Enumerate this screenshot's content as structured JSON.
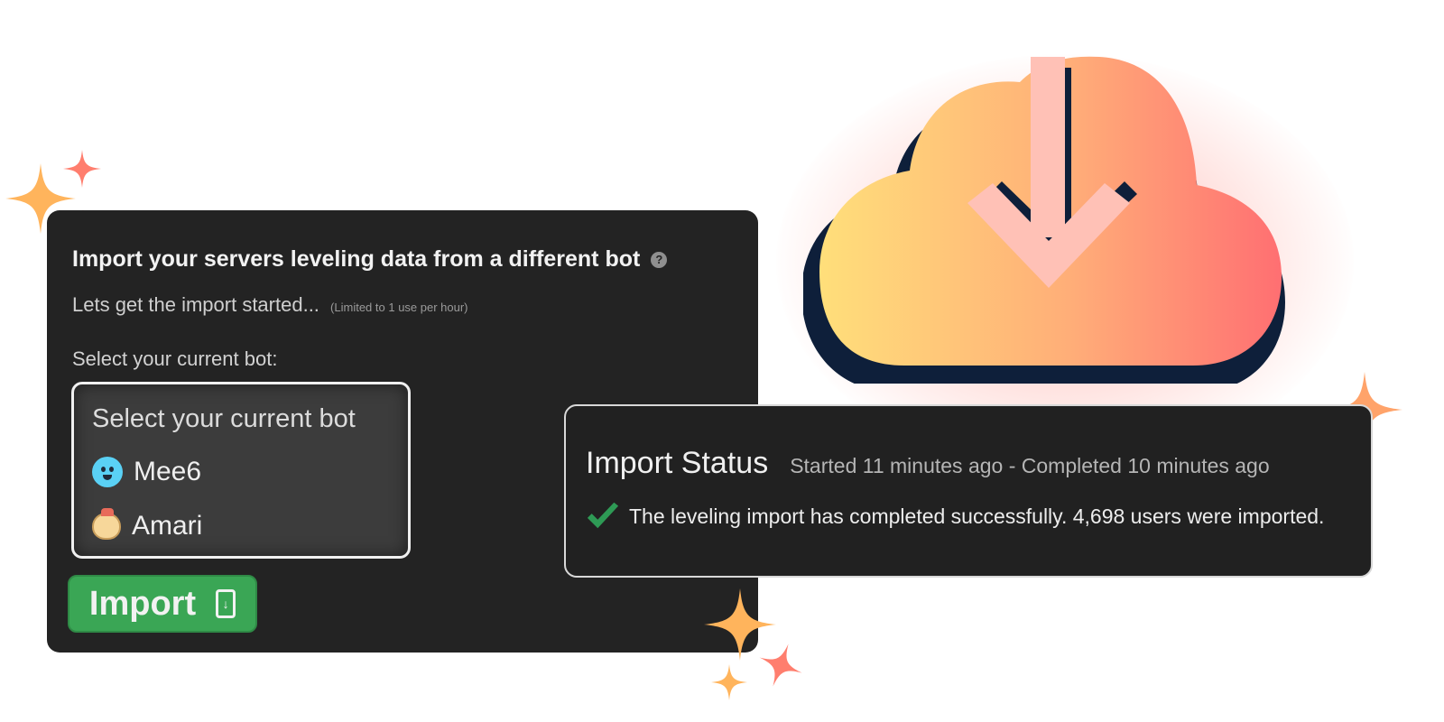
{
  "import_card": {
    "title": "Import your servers leveling data from a different bot",
    "help_icon": "?",
    "subtitle": "Lets get the import started...",
    "limit_note": "(Limited to 1 use per hour)",
    "select_label": "Select your current bot:",
    "select_placeholder": "Select your current bot",
    "bots": [
      {
        "name": "Mee6",
        "icon": "mee6-icon"
      },
      {
        "name": "Amari",
        "icon": "amari-icon"
      }
    ],
    "import_button": "Import",
    "import_button_icon": "download-file-icon"
  },
  "status_panel": {
    "title": "Import Status",
    "timing": "Started 11 minutes ago - Completed 10 minutes ago",
    "message": "The leveling import has completed successfully. 4,698 users were imported.",
    "status_icon": "check-icon"
  },
  "colors": {
    "card_bg": "#232323",
    "accent_green": "#3aa655",
    "check_green": "#2e9a55",
    "cloud_start": "#ffd97a",
    "cloud_end": "#ff7070",
    "cloud_shadow": "#0e1f3a",
    "sparkle_orange": "#ffb060",
    "sparkle_red": "#ff7a6a"
  }
}
